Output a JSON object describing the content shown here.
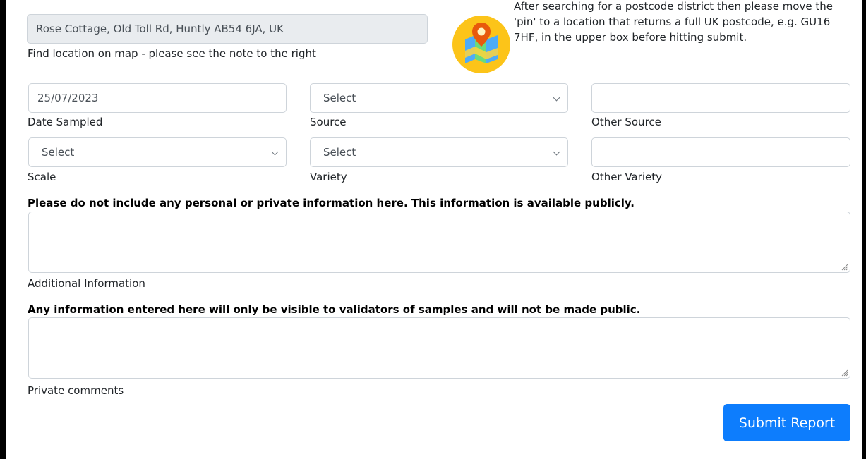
{
  "location": {
    "value": "Rose Cottage, Old Toll Rd, Huntly AB54 6JA, UK",
    "label": "Find location on map - please see the note to the right"
  },
  "note": {
    "icon": "map-pin-icon",
    "text": "After searching for a postcode district then please move the 'pin' to a location that returns a full UK postcode, e.g. GU16 7HF, in the upper box before hitting submit."
  },
  "date_sampled": {
    "value": "25/07/2023",
    "label": "Date Sampled"
  },
  "source": {
    "selected": "Select",
    "label": "Source"
  },
  "other_source": {
    "value": "",
    "label": "Other Source"
  },
  "scale": {
    "selected": "Select",
    "label": "Scale"
  },
  "variety": {
    "selected": "Select",
    "label": "Variety"
  },
  "other_variety": {
    "value": "",
    "label": "Other Variety"
  },
  "additional_info": {
    "warning": "Please do not include any personal or private information here. This information is available publicly.",
    "value": "",
    "label": "Additional Information"
  },
  "private_comments": {
    "warning": "Any information entered here will only be visible to validators of samples and will not be made public.",
    "value": "",
    "label": "Private comments"
  },
  "submit": {
    "label": "Submit Report",
    "color": "#0d7dfd"
  }
}
